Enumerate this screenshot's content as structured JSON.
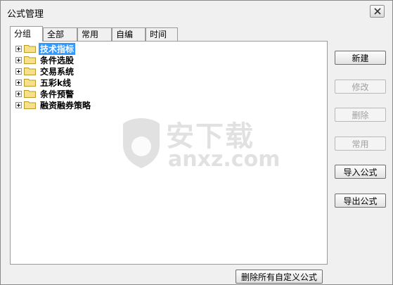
{
  "window": {
    "title": "公式管理"
  },
  "tabs": [
    "分组",
    "全部",
    "常用",
    "自编",
    "时间"
  ],
  "tree": {
    "items": [
      {
        "label": "技术指标",
        "selected": true
      },
      {
        "label": "条件选股",
        "selected": false
      },
      {
        "label": "交易系统",
        "selected": false
      },
      {
        "label": "五彩k线",
        "selected": false
      },
      {
        "label": "条件预警",
        "selected": false
      },
      {
        "label": "融资融券策略",
        "selected": false
      }
    ]
  },
  "buttons": {
    "new": "新建",
    "modify": "修改",
    "delete": "删除",
    "common": "常用",
    "import": "导入公式",
    "export": "导出公式",
    "delete_all_custom": "删除所有自定义公式"
  },
  "watermark": {
    "text_cn": "安下载",
    "text_en": "anxz.com"
  }
}
